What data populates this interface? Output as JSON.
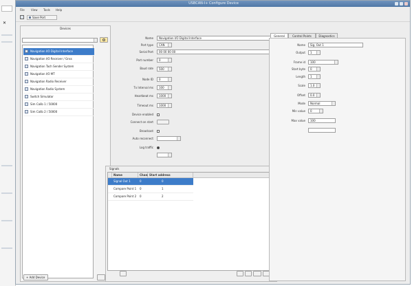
{
  "window": {
    "title": "USBCAN-I+ Configure Device"
  },
  "menu": [
    "File",
    "View",
    "Tools",
    "Help"
  ],
  "toolbar": {
    "save_label": "Save Port"
  },
  "left_panel": {
    "title": "Devices",
    "items": [
      "Navigation I/O Digital Interface",
      "Navigation I/O Receiver / Gnss",
      "Navigation Tach Sender System",
      "Navigation I/O MT",
      "Navigation Radio Receiver",
      "Navigation Radio System",
      "Switch Simulator",
      "Sim Calib 1 / 50000",
      "Sim Calib 2 / 50000"
    ],
    "selected_index": 0,
    "add_label": "+ Add Device"
  },
  "middle_form": {
    "fields": [
      {
        "label": "Name",
        "value": "Navigation I/O Digital Interface"
      },
      {
        "label": "Port type",
        "value": "CAN"
      },
      {
        "label": "Serial Port",
        "value": "00 00 00 00"
      },
      {
        "label": "Port number",
        "value": "0"
      },
      {
        "label": "Baud rate",
        "value": "500"
      },
      {
        "label": "Node ID",
        "value": "0"
      },
      {
        "label": "Tx Interval ms",
        "value": "100"
      },
      {
        "label": "Heartbeat ms",
        "value": "1000"
      },
      {
        "label": "Timeout ms",
        "value": "1000"
      }
    ],
    "checks": [
      {
        "label": "Device enabled",
        "state": "checkbox"
      },
      {
        "label": "Connect on start",
        "state": "checkbox"
      },
      {
        "label": "Broadcast",
        "state": "checkbox"
      },
      {
        "label": "Auto reconnect",
        "state": "radio"
      },
      {
        "label": "Log traffic",
        "state": "radio"
      }
    ]
  },
  "signals": {
    "title": "Signals",
    "columns": [
      "Name",
      "Channel",
      "Start address"
    ],
    "rows": [
      {
        "name": "Signal Out 1",
        "channel": "0",
        "start": "0",
        "selected": true
      },
      {
        "name": "Compare Point 1",
        "channel": "0",
        "start": "1",
        "selected": false
      },
      {
        "name": "Compare Point 2",
        "channel": "0",
        "start": "2",
        "selected": false
      }
    ]
  },
  "right_panel": {
    "tabs": [
      "General",
      "Control Points",
      "Diagnostics"
    ],
    "active_tab": 0,
    "fields": [
      {
        "label": "Name",
        "value": "Sig. Out 1"
      },
      {
        "label": "Output",
        "value": "1"
      },
      {
        "label": "Frame id",
        "value": "100"
      },
      {
        "label": "Start byte",
        "value": "0"
      },
      {
        "label": "Length",
        "value": "1"
      },
      {
        "label": "Scale",
        "value": "1.0"
      },
      {
        "label": "Offset",
        "value": "0.0"
      },
      {
        "label": "Mode",
        "value": "Normal"
      },
      {
        "label": "Min value",
        "value": "0"
      },
      {
        "label": "Max value",
        "value": "100"
      }
    ]
  }
}
